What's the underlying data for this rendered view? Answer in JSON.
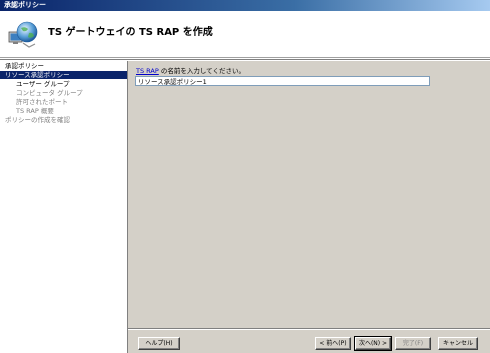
{
  "window": {
    "title": "承認ポリシー"
  },
  "header": {
    "heading": "TS ゲートウェイの TS RAP を作成"
  },
  "nav": {
    "items": [
      {
        "label": "承認ポリシー",
        "selected": false,
        "sub": false,
        "disabled": false
      },
      {
        "label": "リソース承認ポリシー",
        "selected": true,
        "sub": false,
        "disabled": false
      },
      {
        "label": "ユーザー グループ",
        "selected": false,
        "sub": true,
        "disabled": false
      },
      {
        "label": "コンピュータ グループ",
        "selected": false,
        "sub": true,
        "disabled": true
      },
      {
        "label": "許可されたポート",
        "selected": false,
        "sub": true,
        "disabled": true
      },
      {
        "label": "TS RAP 概要",
        "selected": false,
        "sub": true,
        "disabled": true
      },
      {
        "label": "ポリシーの作成を確認",
        "selected": false,
        "sub": false,
        "disabled": true
      }
    ]
  },
  "main": {
    "prompt_link": "TS RAP",
    "prompt_text": " の名前を入力してください。",
    "name_value": "リソース承認ポリシー1"
  },
  "buttons": {
    "help": "ヘルプ(H)",
    "back": "< 前へ(P)",
    "next": "次へ(N) >",
    "finish": "完了(F)",
    "cancel": "キャンセル"
  },
  "colors": {
    "selection": "#0a246a",
    "panel": "#d4d0c8",
    "link": "#0000cc"
  },
  "icons": {
    "wizard": "globe-with-computer-icon"
  }
}
